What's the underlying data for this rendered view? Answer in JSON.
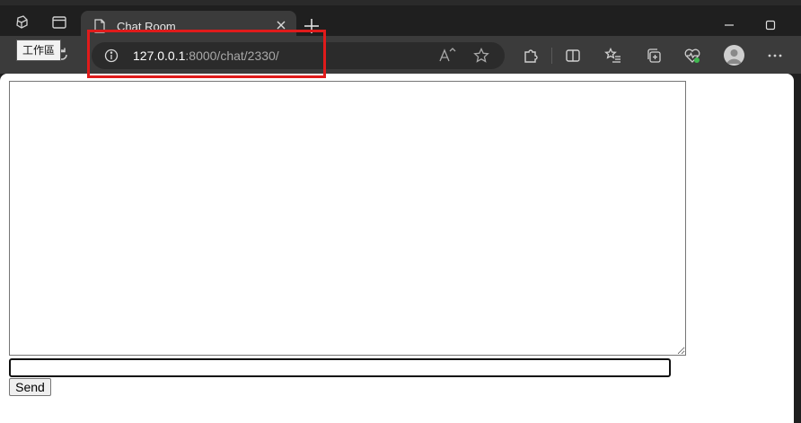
{
  "browser": {
    "tab": {
      "title": "Chat Room"
    },
    "tooltip": "工作區",
    "address": {
      "host": "127.0.0.1",
      "path": ":8000/chat/2330/"
    },
    "accent_highlight": "#e01b1b"
  },
  "icons": {
    "workspaces": "workspaces-icon",
    "tab_actions": "tab-actions-icon",
    "document": "document-icon",
    "close": "close-icon",
    "new_tab": "plus-icon",
    "minimize": "minimize-icon",
    "maximize": "maximize-icon",
    "refresh": "refresh-icon",
    "info": "info-icon",
    "read_aloud": "read-aloud-icon",
    "favorite": "star-icon",
    "extensions": "puzzle-icon",
    "split_screen": "split-screen-icon",
    "favorites_bar": "favorites-list-icon",
    "collections": "collections-icon",
    "browser_essentials": "heart-pulse-icon",
    "profile": "profile-avatar-icon",
    "more": "more-options-icon"
  },
  "chat": {
    "log": "",
    "input_value": "",
    "send_label": "Send"
  }
}
